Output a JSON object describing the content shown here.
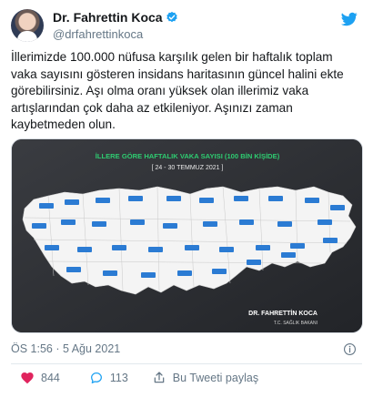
{
  "author": {
    "name": "Dr. Fahrettin Koca",
    "handle": "@drfahrettinkoca",
    "verified": true
  },
  "icons": {
    "twitter": "twitter-bird-icon",
    "verified": "verified-badge-icon",
    "info": "info-icon",
    "like": "heart-icon",
    "reply": "reply-bubble-icon",
    "share": "share-icon"
  },
  "colors": {
    "twitter_blue": "#1da1f2",
    "like_red": "#e0245e",
    "muted": "#657786",
    "map_bg": "#2b2d31",
    "map_land": "#ffffff",
    "map_title": "#2ecc71"
  },
  "tweet": {
    "text": "İllerimizde 100.000 nüfusa karşılık gelen bir haftalık toplam vaka sayısını gösteren insidans haritasının güncel halini ekte görebilirsiniz. Aşı olma oranı yüksek olan illerimiz vaka artışlarından çok daha az etkileniyor. Aşınızı zaman kaybetmeden olun.",
    "timestamp": "ÖS 1:56 · 5 Ağu 2021"
  },
  "media": {
    "title": "İLLERE GÖRE HAFTALIK VAKA SAYISI (100 BİN KİŞİDE)",
    "subtitle": "[ 24 - 30 TEMMUZ 2021 ]",
    "signature_name": "DR. FAHRETTİN KOCA",
    "signature_role": "T.C. SAĞLIK BAKANI"
  },
  "actions": {
    "likes": "844",
    "replies": "113",
    "share_label": "Bu Tweeti paylaş"
  }
}
